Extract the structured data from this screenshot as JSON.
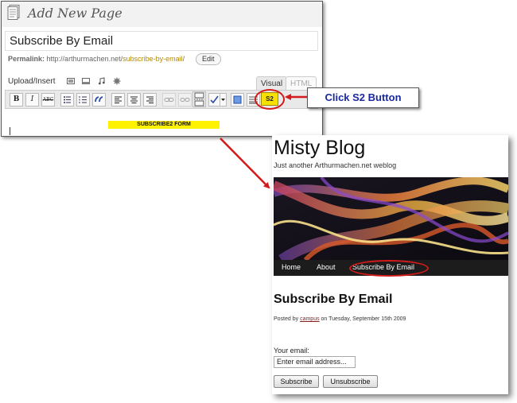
{
  "editor": {
    "heading": "Add New Page",
    "post_title": "Subscribe By Email",
    "permalink_label": "Permalink:",
    "permalink_base": "http://arthurmachen.net/",
    "permalink_slug": "subscribe-by-email",
    "permalink_trail": "/",
    "edit_label": "Edit",
    "upload_label": "Upload/Insert",
    "tab_visual": "Visual",
    "tab_html": "HTML",
    "toolbar": {
      "bold": "B",
      "italic": "I",
      "strike": "ABC",
      "s2": "S2"
    },
    "content_marker": "SUBSCRIBE2 FORM"
  },
  "callout": {
    "text": "Click S2 Button"
  },
  "blog": {
    "site_title": "Misty Blog",
    "tagline": "Just another Arthurmachen.net weblog",
    "nav": [
      "Home",
      "About",
      "Subscribe By Email"
    ],
    "post_title": "Subscribe By Email",
    "posted_prefix": "Posted by ",
    "author": "campus",
    "posted_suffix": " on Tuesday, September 15th 2009",
    "email_label": "Your email:",
    "email_placeholder": "Enter email address...",
    "subscribe_label": "Subscribe",
    "unsubscribe_label": "Unsubscribe"
  },
  "colors": {
    "annotation_red": "#d41a1a",
    "callout_text": "#1a2a9c",
    "s2_yellow": "#f8e000",
    "marker_yellow": "#fff200",
    "nav_bg": "#1c1c1c"
  }
}
